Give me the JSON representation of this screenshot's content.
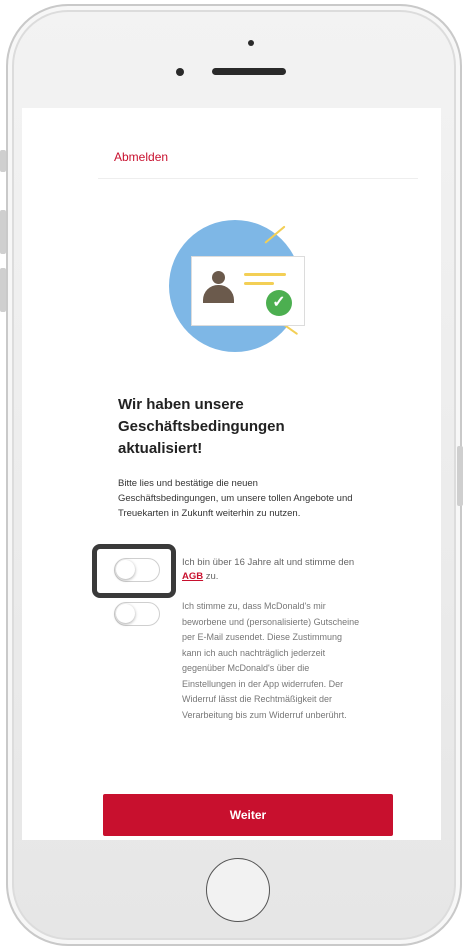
{
  "header": {
    "logout_label": "Abmelden"
  },
  "main": {
    "heading": "Wir haben unsere Geschäftsbedingungen aktualisiert!",
    "intro": "Bitte lies und bestätige die neuen Geschäftsbedingungen, um unsere tollen Angebote und Treuekarten in Zukunft weiterhin zu nutzen.",
    "consent_age": {
      "text_before": "Ich bin über 16 Jahre alt und stimme den ",
      "agb_link": "AGB",
      "text_after": " zu.",
      "checked": false
    },
    "consent_marketing": {
      "text": "Ich stimme zu, dass McDonald's mir beworbene und (personalisierte) Gutscheine per E-Mail zusendet. Diese Zustimmung kann ich auch nachträglich jederzeit gegenüber McDonald's über die Einstellungen in der App widerrufen. Der Widerruf lässt die Rechtmäßigkeit der Verarbeitung bis zum Widerruf unberührt.",
      "checked": false
    },
    "continue_label": "Weiter"
  },
  "colors": {
    "brand_red": "#c8102e",
    "illustration_bg": "#7eb7e6",
    "check_green": "#4caf50",
    "highlight_frame": "#3a3a3a"
  },
  "icons": {
    "illustration": "id-card-with-checkmark-icon",
    "home": "home-button-icon"
  }
}
